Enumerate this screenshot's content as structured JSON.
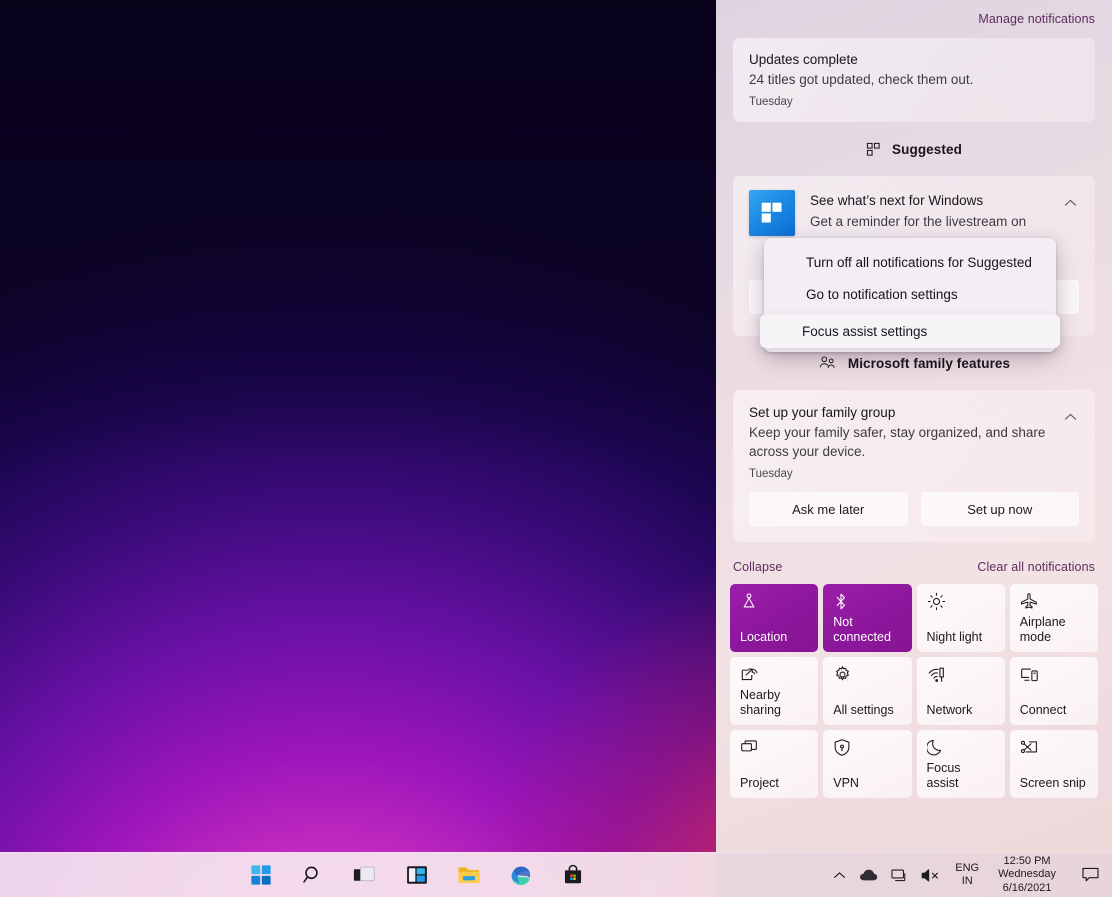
{
  "desktop": {
    "wallpaper_name": "windows-bloom-wallpaper"
  },
  "action_center": {
    "manage_notifications_label": "Manage notifications",
    "collapse_label": "Collapse",
    "clear_all_label": "Clear all notifications",
    "notifications": [
      {
        "id": "updates-complete",
        "title": "Updates complete",
        "body": "24 titles got updated, check them out.",
        "time": "Tuesday"
      }
    ],
    "suggested": {
      "header_label": "Suggested",
      "header_icon": "tiles-icon",
      "card": {
        "app_icon": "windows-logo-icon",
        "title": "See what’s next for Windows",
        "body": "Get a reminder for the livestream on",
        "collapse_icon": "chevron-up-icon"
      }
    },
    "family": {
      "header_label": "Microsoft family features",
      "header_icon": "people-icon",
      "card": {
        "title": "Set up your family group",
        "body": "Keep your family safer, stay organized, and share across your device.",
        "time": "Tuesday",
        "collapse_icon": "chevron-up-icon",
        "buttons": [
          {
            "label": "Ask me later"
          },
          {
            "label": "Set up now"
          }
        ]
      }
    },
    "quick_actions": [
      {
        "label": "Location",
        "icon": "location-icon",
        "active": true,
        "lines": 1
      },
      {
        "label": "Not connected",
        "icon": "bluetooth-icon",
        "active": true,
        "lines": 2
      },
      {
        "label": "Night light",
        "icon": "brightness-icon",
        "active": false,
        "lines": 1
      },
      {
        "label": "Airplane mode",
        "icon": "airplane-icon",
        "active": false,
        "lines": 2
      },
      {
        "label": "Nearby sharing",
        "icon": "nearby-sharing-icon",
        "active": false,
        "lines": 2
      },
      {
        "label": "All settings",
        "icon": "gear-icon",
        "active": false,
        "lines": 1
      },
      {
        "label": "Network",
        "icon": "network-icon",
        "active": false,
        "lines": 1
      },
      {
        "label": "Connect",
        "icon": "connect-icon",
        "active": false,
        "lines": 1
      },
      {
        "label": "Project",
        "icon": "project-icon",
        "active": false,
        "lines": 1
      },
      {
        "label": "VPN",
        "icon": "vpn-shield-icon",
        "active": false,
        "lines": 1
      },
      {
        "label": "Focus assist",
        "icon": "moon-icon",
        "active": false,
        "lines": 1
      },
      {
        "label": "Screen snip",
        "icon": "scissors-icon",
        "active": false,
        "lines": 1
      }
    ]
  },
  "context_menu": {
    "items": [
      {
        "label": "Turn off all notifications for Suggested",
        "highlighted": false
      },
      {
        "label": "Go to notification settings",
        "highlighted": false
      },
      {
        "label": "Focus assist settings",
        "highlighted": true
      }
    ]
  },
  "taskbar": {
    "icons": [
      {
        "name": "start-button",
        "label": "Start"
      },
      {
        "name": "search-button",
        "label": "Search"
      },
      {
        "name": "task-view-button",
        "label": "Task view"
      },
      {
        "name": "widgets-button",
        "label": "Widgets"
      },
      {
        "name": "file-explorer-button",
        "label": "File Explorer"
      },
      {
        "name": "edge-button",
        "label": "Microsoft Edge"
      },
      {
        "name": "store-button",
        "label": "Microsoft Store"
      }
    ],
    "tray": {
      "overflow_icon": "chevron-up-icon",
      "onedrive_icon": "cloud-icon",
      "network_icon": "network-icon",
      "volume_icon": "speaker-muted-icon",
      "language_primary": "ENG",
      "language_secondary": "IN",
      "time": "12:50 PM",
      "day": "Wednesday",
      "date": "6/16/2021",
      "notification_icon": "notification-bubble-icon"
    }
  },
  "colors": {
    "accent_tile_on": "#8d179c",
    "link_text": "#5d2c5f",
    "panel_top": "#ded4e0",
    "panel_bottom": "#ecd9da"
  }
}
